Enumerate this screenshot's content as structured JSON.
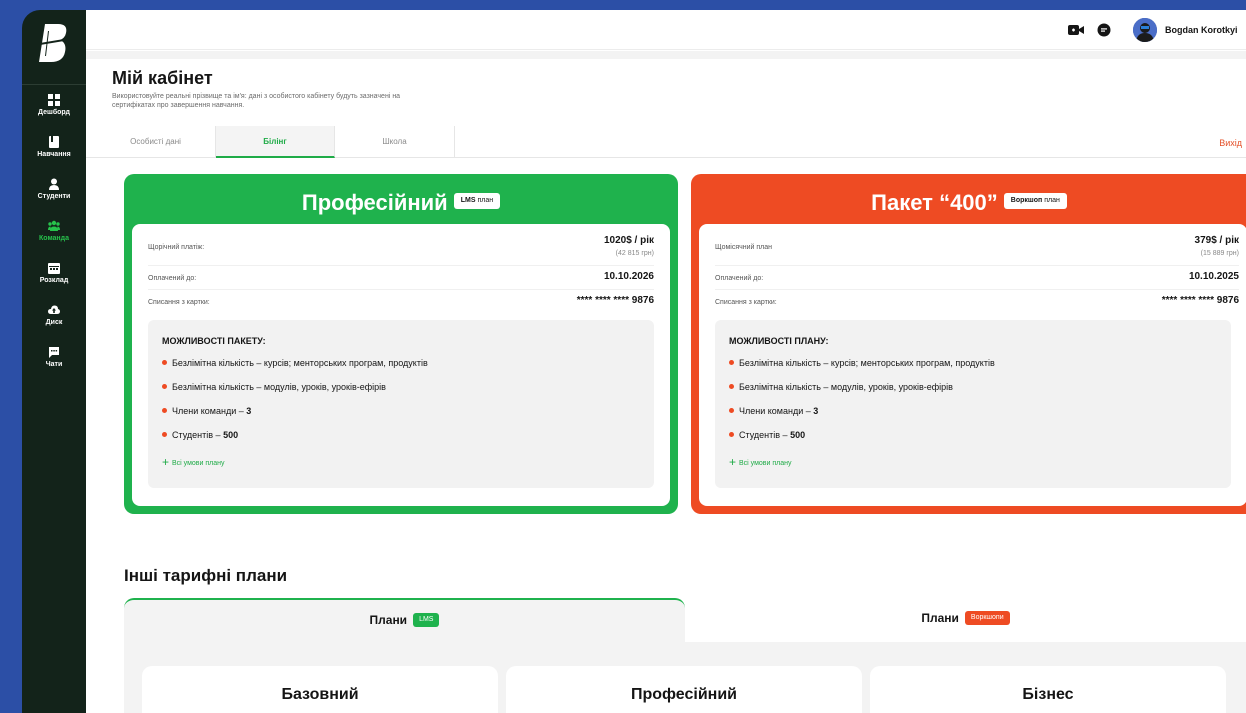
{
  "sidebar": {
    "items": [
      {
        "label": "Дешборд",
        "icon": "dashboard-icon"
      },
      {
        "label": "Навчання",
        "icon": "book-icon"
      },
      {
        "label": "Студенти",
        "icon": "student-icon"
      },
      {
        "label": "Команда",
        "icon": "team-icon"
      },
      {
        "label": "Розклад",
        "icon": "calendar-icon"
      },
      {
        "label": "Диск",
        "icon": "cloud-icon"
      },
      {
        "label": "Чати",
        "icon": "chat-icon"
      }
    ],
    "active_item": "Команда"
  },
  "header": {
    "user_name": "Bogdan Korotkyi",
    "icons": [
      "video-icon",
      "message-icon"
    ]
  },
  "page": {
    "title": "Мій кабінет",
    "description": "Використовуйте реальні прізвище та ім'я: дані з особистого кабінету будуть зазначені на сертифікатах про завершення навчання."
  },
  "tabs": [
    {
      "label": "Особисті дані"
    },
    {
      "label": "Білінг"
    },
    {
      "label": "Школа"
    }
  ],
  "active_tab": "Білінг",
  "logout_label": "Вихід",
  "plans": {
    "lms": {
      "title": "Професійний",
      "badge_bold": "LMS",
      "badge_rest": "план",
      "payment_label": "Щорічний платіж:",
      "payment_value": "1020$ / рік",
      "payment_sub": "(42 815 грн)",
      "paid_label": "Оплачений до:",
      "paid_value": "10.10.2026",
      "card_label": "Списання з картки:",
      "card_value": "**** **** **** 9876",
      "features_title": "МОЖЛИВОСТІ ПАКЕТУ:",
      "features": [
        {
          "text": "Безлімітна кількість – курсів; менторських програм, продуктів",
          "bold": ""
        },
        {
          "text": "Безлімітна кількість – модулів, уроків, уроків-ефірів",
          "bold": ""
        },
        {
          "text": "Члени команди – ",
          "bold": "3"
        },
        {
          "text": "Студентів – ",
          "bold": "500"
        }
      ],
      "link": "Всі умови плану"
    },
    "workshop": {
      "title": "Пакет “400”",
      "badge_bold": "Воркшоп",
      "badge_rest": "план",
      "payment_label": "Щомісячний план",
      "payment_value": "379$ / рік",
      "payment_sub": "(15 889 грн)",
      "paid_label": "Оплачений до:",
      "paid_value": "10.10.2025",
      "card_label": "Списання з картки:",
      "card_value": "**** **** **** 9876",
      "features_title": "МОЖЛИВОСТІ ПЛАНУ:",
      "features": [
        {
          "text": "Безлімітна кількість – курсів; менторських програм, продуктів",
          "bold": ""
        },
        {
          "text": "Безлімітна кількість – модулів, уроків, уроків-ефірів",
          "bold": ""
        },
        {
          "text": "Члени команди – ",
          "bold": "3"
        },
        {
          "text": "Студентів – ",
          "bold": "500"
        }
      ],
      "link": "Всі умови плану"
    }
  },
  "other": {
    "title": "Інші тарифні плани",
    "tabs": [
      {
        "label": "Плани",
        "badge": "LMS"
      },
      {
        "label": "Плани",
        "badge": "Воркшопи"
      }
    ],
    "cards": [
      "Базовний",
      "Професійний",
      "Бізнес"
    ]
  },
  "colors": {
    "green": "#1fb24d",
    "red": "#ee4b23",
    "sidebar": "#13231a",
    "frame": "#2c4fa6"
  }
}
